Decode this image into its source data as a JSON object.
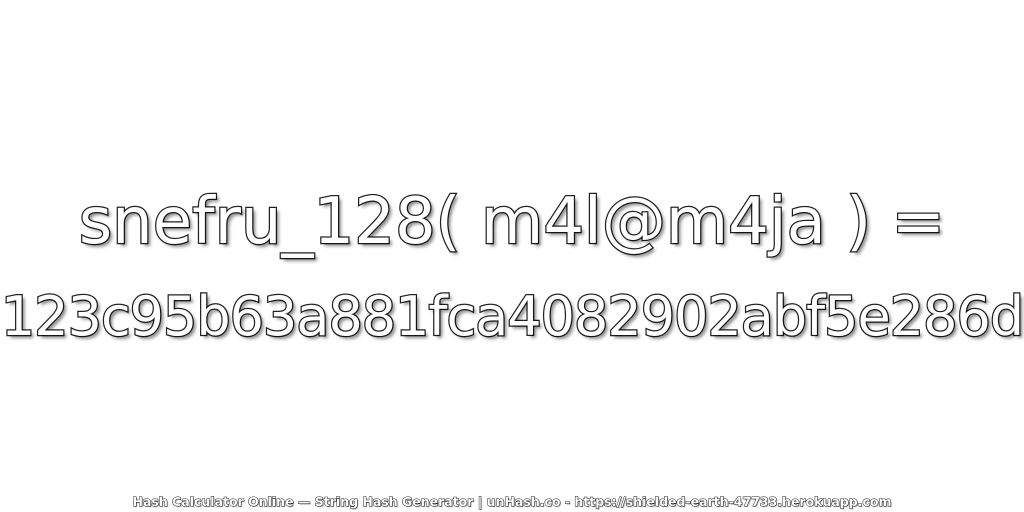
{
  "heading": {
    "expression": "snefru_128( m4l@m4ja ) =",
    "hash_value": "123c95b63a881fca4082902abf5e286d"
  },
  "footer": {
    "credit": "Hash Calculator Online — String Hash Generator | unHash.co - https://shielded-earth-47733.herokuapp.com"
  },
  "colors": {
    "background": "#ffffff",
    "text_fill": "#ffffff",
    "text_outline": "#222222"
  }
}
